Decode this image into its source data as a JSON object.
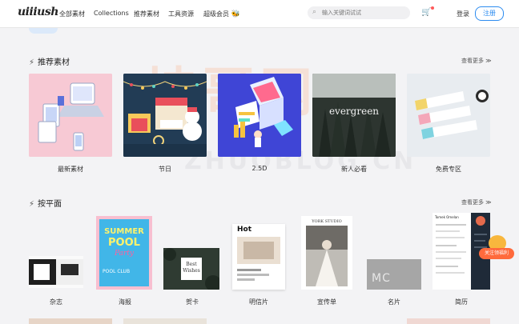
{
  "header": {
    "logo": "uiiiush",
    "nav": [
      "全部素材",
      "Collections",
      "推荐素材",
      "工具资源",
      "超级会员"
    ],
    "search_placeholder": "输入关键词试试",
    "login": "登录",
    "register": "注册"
  },
  "section1": {
    "title": "推荐素材",
    "more": "查看更多 ≫",
    "cards": [
      {
        "label": "最新素材"
      },
      {
        "label": "节日"
      },
      {
        "label": "2.5D"
      },
      {
        "label": "新人必看",
        "image_text": "evergreen"
      },
      {
        "label": "免费专区"
      }
    ]
  },
  "section2": {
    "title": "按平面",
    "more": "查看更多 ≫",
    "items": [
      {
        "label": "杂志"
      },
      {
        "label": "海报",
        "image_text": [
          "SUMMER",
          "POOL",
          "Party",
          "POOL CLUB"
        ]
      },
      {
        "label": "贺卡",
        "image_text": [
          "Best",
          "Wishes"
        ]
      },
      {
        "label": "明信片",
        "image_text": "Hot"
      },
      {
        "label": "宣传单",
        "image_text": "YORK STUDIO"
      },
      {
        "label": "名片",
        "image_text": "MC"
      },
      {
        "label": "简历",
        "image_text": "Tomek Omelan"
      }
    ]
  },
  "float_button": {
    "label": "关注领福利"
  },
  "watermark": {
    "main": "坤哥网",
    "sub": "ZHUOBLOG.CN"
  }
}
